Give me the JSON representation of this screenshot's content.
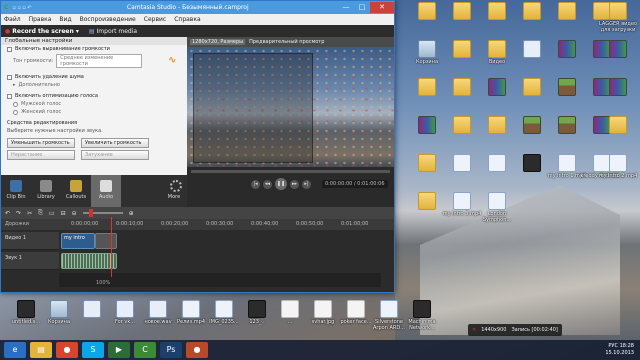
{
  "window": {
    "app_name": "Camtasia Studio",
    "title": "Camtasia Studio - Безымянный.camproj",
    "minimize": "—",
    "maximize": "□",
    "close": "✕"
  },
  "menu": [
    "Файл",
    "Правка",
    "Вид",
    "Воспроизведение",
    "Сервис",
    "Справка"
  ],
  "toolbar": {
    "record": "Record the screen ▾",
    "import": "Import media"
  },
  "audio_panel": {
    "global_header": "Глобальные настройки",
    "volume_leveling": "Включить выравнивание громкости",
    "volume_tone_label": "Тон громкости:",
    "volume_tone_value": "Среднее изменение громкости",
    "noise_removal": "Включить удаление шума",
    "advanced": "Дополнительно",
    "voice_optimization": "Включить оптимизацию голоса",
    "male_voice": "Мужской голос",
    "female_voice": "Женский голос",
    "editing_header": "Средства редактирования",
    "select_hint": "Выберите нужные настройки звука.",
    "decrease_volume": "Уменьшить громкость",
    "increase_volume": "Увеличить громкость",
    "fade_in": "Нарастание",
    "fade_out": "Затухание"
  },
  "tabs": [
    {
      "label": "Clip Bin",
      "icon": "film-icon"
    },
    {
      "label": "Library",
      "icon": "library-icon"
    },
    {
      "label": "Callouts",
      "icon": "callout-icon"
    },
    {
      "label": "Audio",
      "icon": "speaker-icon"
    },
    {
      "label": "More",
      "icon": "more-icon"
    }
  ],
  "preview": {
    "resolution": "1280x720, Размеры",
    "mode": "Предварительный просмотр",
    "timecode": "0:00:00:00 / 0:01:00:06"
  },
  "timeline": {
    "ruler": [
      "0:00:00;00",
      "0:00:10;00",
      "0:00:20;00",
      "0:00:30;00",
      "0:00:40;00",
      "0:00:50;00",
      "0:01:00;00"
    ],
    "tracks_label": "Дорожки",
    "video_track": "Видео 1",
    "audio_track": "Звук 1",
    "video_clip": "my intro",
    "zoom": "100%"
  },
  "desktop_icons": [
    {
      "label": "",
      "type": "folder"
    },
    {
      "label": "",
      "type": "folder"
    },
    {
      "label": "",
      "type": "folder"
    },
    {
      "label": "",
      "type": "folder"
    },
    {
      "label": "",
      "type": "folder"
    },
    {
      "label": "",
      "type": "folder"
    },
    {
      "label": "LAGGER видео для загрузки",
      "type": "folder"
    },
    {
      "label": "Корзина",
      "type": "recycle"
    },
    {
      "label": "",
      "type": "folder"
    },
    {
      "label": "Видео",
      "type": "folder"
    },
    {
      "label": "",
      "type": "wav"
    },
    {
      "label": "",
      "type": "rar"
    },
    {
      "label": "",
      "type": "rar"
    },
    {
      "label": "",
      "type": "rar"
    },
    {
      "label": "",
      "type": "folder"
    },
    {
      "label": "",
      "type": "folder"
    },
    {
      "label": "",
      "type": "rar"
    },
    {
      "label": "",
      "type": "folder"
    },
    {
      "label": "",
      "type": "mc"
    },
    {
      "label": "",
      "type": "rar"
    },
    {
      "label": "",
      "type": "rar"
    },
    {
      "label": "",
      "type": "rar"
    },
    {
      "label": "",
      "type": "folder"
    },
    {
      "label": "",
      "type": "folder"
    },
    {
      "label": "",
      "type": "mc"
    },
    {
      "label": "",
      "type": "mc"
    },
    {
      "label": "",
      "type": "rar"
    },
    {
      "label": "",
      "type": "folder"
    },
    {
      "label": "",
      "type": "folder"
    },
    {
      "label": "",
      "type": "mp4"
    },
    {
      "label": "",
      "type": "mp4"
    },
    {
      "label": "",
      "type": "video"
    },
    {
      "label": "my intro 1.mp4",
      "type": "mp4"
    },
    {
      "label": "kreddy Android...",
      "type": "mp4"
    },
    {
      "label": "my intro 2.mp4",
      "type": "mp4"
    },
    {
      "label": "",
      "type": "folder"
    },
    {
      "label": "my intro 3.mp4",
      "type": "mp4"
    },
    {
      "label": "London Symphon...",
      "type": "mp4"
    },
    {
      "label": "untitled.s...",
      "type": "video"
    },
    {
      "label": "Корзина",
      "type": "recycle"
    },
    {
      "label": "",
      "type": "wav"
    },
    {
      "label": "For vk...",
      "type": "wav"
    },
    {
      "label": "новое.wav",
      "type": "wav"
    },
    {
      "label": "Релиз.mp4",
      "type": "mp4"
    },
    {
      "label": "IMG_0235...",
      "type": "mp4"
    },
    {
      "label": "123_..",
      "type": "video"
    },
    {
      "label": "...",
      "type": "file"
    },
    {
      "label": "svhar.jpg",
      "type": "file"
    },
    {
      "label": "poker face...",
      "type": "file"
    },
    {
      "label": "Silverstone Arpon ARD...",
      "type": "mp4"
    },
    {
      "label": "Machinima Network...",
      "type": "video"
    }
  ],
  "recorder_pill": {
    "size": "1440x900",
    "status": "Запись [00:02:40]"
  },
  "tray": {
    "lang": "РУС",
    "time": "18:28",
    "date": "15.10.2013"
  },
  "taskbar": [
    {
      "name": "ie-icon",
      "bg": "#2b6fc5",
      "glyph": "e"
    },
    {
      "name": "explorer-icon",
      "bg": "#e3b33a",
      "glyph": "▤"
    },
    {
      "name": "chrome-icon",
      "bg": "#d8452d",
      "glyph": "●"
    },
    {
      "name": "skype-icon",
      "bg": "#0aa6e8",
      "glyph": "S"
    },
    {
      "name": "media-icon",
      "bg": "#2d6b3a",
      "glyph": "▶"
    },
    {
      "name": "camtasia-icon",
      "bg": "#3a8a3a",
      "glyph": "C"
    },
    {
      "name": "photoshop-icon",
      "bg": "#1c3f6b",
      "glyph": "Ps"
    },
    {
      "name": "recorder-icon",
      "bg": "#b84a2a",
      "glyph": "●"
    }
  ]
}
